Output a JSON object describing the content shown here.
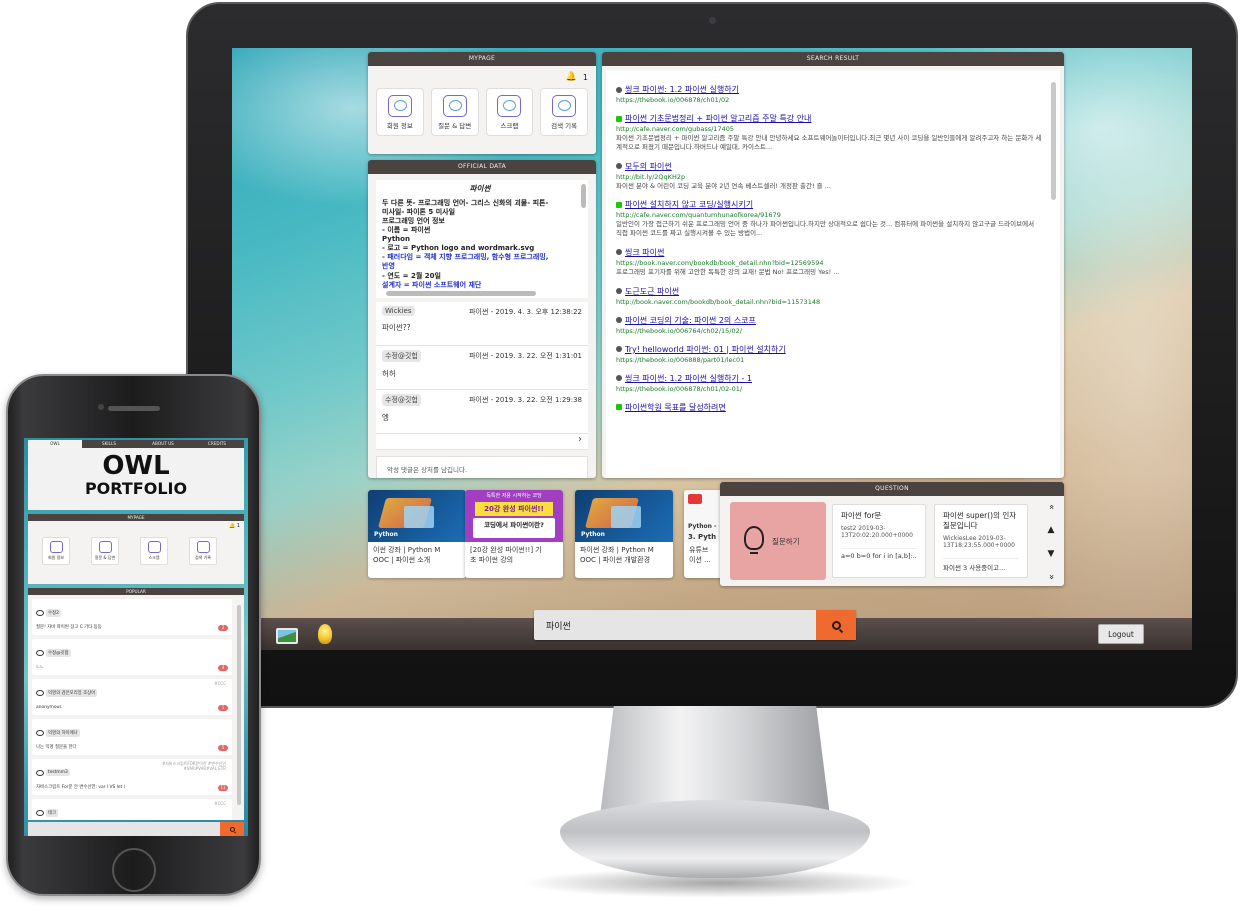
{
  "monitor": {
    "mypage": {
      "header": "MYPAGE",
      "notification_count": "1",
      "buttons": [
        {
          "label": "회원 정보",
          "icon": "member-info-icon"
        },
        {
          "label": "질문 & 답변",
          "icon": "qna-icon"
        },
        {
          "label": "스크랩",
          "icon": "scrap-icon"
        },
        {
          "label": "검색 기록",
          "icon": "search-history-icon"
        }
      ]
    },
    "official_data": {
      "header": "OFFICIAL DATA",
      "title": "파이썬",
      "lines": [
        "두 다른 뜻- 프로그래밍 언어- 그리스 신화의 괴물- 피톤-",
        "미사일- 파이톤 5 미사일",
        "프로그래밍 언어 정보",
        "- 이름 = 파이썬",
        "Python",
        "- 로고 = Python logo and wordmark.svg",
        "- 패러다임 = 객체 지향 프로그래밍, 함수형 프로그래밍,",
        "반영",
        "- 연도 = 2월 20일",
        "설계자 = 파이썬 소프트웨어 재단"
      ],
      "comments": [
        {
          "user": "Wickies",
          "meta": "파이썬 - 2019. 4. 3. 오후 12:38:22",
          "text": "파이썬??"
        },
        {
          "user": "수정@깃헙",
          "meta": "파이썬 - 2019. 3. 22. 오전 1:31:01",
          "text": "허허"
        },
        {
          "user": "수정@깃헙",
          "meta": "파이썬 - 2019. 3. 22. 오전 1:29:38",
          "text": "엥"
        }
      ],
      "next_arrow": "›",
      "comment_placeholder": "악성 댓글은 상처를 남깁니다."
    },
    "search_result": {
      "header": "SEARCH RESULT",
      "results": [
        {
          "type": "web",
          "title": "씽크 파이썬: 1.2 파이썬 실행하기",
          "url": "https://thebook.io/006878/ch01/02",
          "desc": ""
        },
        {
          "type": "naver",
          "title": "파이썬 기초문법정리 + 파이썬 알고리즘 주말 특강 안내",
          "url": "http://cafe.naver.com/gubass/17405",
          "desc": "파이썬 기초문법정리 + 파이썬 알고리즘 주말 특강 안내 안녕하세요 소프트웨어놀이터입니다.최근 몇년 사이 코딩을 일반인들에게 알려주고자 하는 문화가 세계적으로 퍼졌기 때문입니다.하버드나 예일대, 카이스트..."
        },
        {
          "type": "web",
          "title": "모두의 파이썬",
          "url": "http://bit.ly/2QqKH2p",
          "desc": "파이썬 분야 & 어린이 코딩 교육 분야 2년 연속 베스트셀러! 개정판 출간! 즐 ..."
        },
        {
          "type": "naver",
          "title": "파이썬 설치하지 않고 코딩/실행시키기",
          "url": "http://cafe.naver.com/quantumhunaofkorea/91679",
          "desc": "일반인이 가장 접근하기 쉬운 프로그래밍 언어 중 하나가 파이썬입니다.하지만 상대적으로 쉽다는 것... 컴퓨터에 파이썬을 설치하지 않고구글 드라이브에서 직접 파이썬 코드를 짜고 실행시켜볼 수 있는 방법이..."
        },
        {
          "type": "web",
          "title": "씽크 파이썬",
          "url": "https://book.naver.com/bookdb/book_detail.nhn?bid=12569594",
          "desc": "프로그래밍 포기자를 위해 고안한 독특한 강의 교재! 문법 No! 프로그래밍 Yes! ..."
        },
        {
          "type": "web",
          "title": "도근도근 파이썬",
          "url": "http://book.naver.com/bookdb/book_detail.nhn?bid=11573148",
          "desc": ""
        },
        {
          "type": "web",
          "title": "파이썬 코딩의 기술: 파이썬 2의 스코프",
          "url": "https://thebook.io/006764/ch02/15/02/",
          "desc": ""
        },
        {
          "type": "web",
          "title": "Try! helloworld 파이썬: 01 | 파이썬 설치하기",
          "url": "https://thebook.io/006888/part01/lec01",
          "desc": ""
        },
        {
          "type": "web",
          "title": "씽크 파이썬: 1.2 파이썬 실행하기 - 1",
          "url": "https://thebook.io/006878/ch01/02-01/",
          "desc": ""
        },
        {
          "type": "naver",
          "title": "파이썬학원 목표를 달성하려면",
          "url": "",
          "desc": ""
        }
      ]
    },
    "videos": [
      {
        "thumb": "python",
        "word": "Python",
        "caption1": "이썬 강좌 | Python M",
        "caption2": "OOC | 파이썬 소개"
      },
      {
        "thumb": "purple",
        "top": "독특한 저용 시작하는 코딩",
        "banner": "20강 완성 파이썬!!",
        "box": "코딩에서 파이썬이란?",
        "caption1": "[20강 완성 파이썬!!] 기",
        "caption2": "초 파이썬 강의"
      },
      {
        "thumb": "python",
        "word": "Python",
        "caption1": "파이썬 강좌 | Python M",
        "caption2": "OOC | 파이썬 개발환경"
      },
      {
        "thumb": "youtube",
        "word": "Python -",
        "caption1": "유튜브",
        "caption2": "이션 ..."
      }
    ],
    "video_partial_text": "3. Pyth",
    "question": {
      "header": "QUESTION",
      "ask_label": "질문하기",
      "cards": [
        {
          "title": "파이썬 for문",
          "meta": "test2 2019-03-13T20:02:20.000+0000",
          "excerpt": "a=0 b=0 for i in [a,b]:..."
        },
        {
          "title": "파이썬 super()의 인자 질문입니다",
          "meta": "WickiesLee 2019-03-13T18:23:55.000+0000",
          "excerpt": "파이썬 3 사용중이고..."
        }
      ],
      "arrows": [
        "«",
        "▲",
        "▼",
        "»"
      ]
    },
    "search": {
      "value": "파이썬"
    },
    "logout_label": "Logout"
  },
  "phone": {
    "tabs": [
      "OWL",
      "SKILLS",
      "ABOUT US",
      "CREDITS"
    ],
    "hero_title": "OWL",
    "hero_subtitle": "PORTFOLIO",
    "mypage": {
      "header": "MYPAGE",
      "notification_count": "1",
      "buttons": [
        "회원 정보",
        "질문 & 답변",
        "스크랩",
        "검색 기록"
      ]
    },
    "popular": {
      "header": "POPULAR",
      "items": [
        {
          "user": "수정2",
          "tags": "",
          "text": "질문! 자바 파이썬 장고 C 기타 등등",
          "count": "2"
        },
        {
          "user": "수정@깃헙",
          "tags": "",
          "text": "ㄴㄴ",
          "count": "4"
        },
        {
          "user": "익명의 검은모리앙 조상어",
          "tags": "#CCC",
          "text": "anonymous",
          "count": "1"
        },
        {
          "user": "익명의 하이에나",
          "tags": "",
          "text": "나는 익명 질문을 한다",
          "count": "5"
        },
        {
          "user": "testmm3",
          "tags": "#자바스크립트FOR문이란 #변수선언#VAR#VAR#VAL ETR",
          "text": "자바스크립트 For문 안 변수선언: var l VS let l",
          "count": "11"
        },
        {
          "user": "테크",
          "tags": "#CCC",
          "text": "",
          "count": ""
        }
      ]
    }
  }
}
